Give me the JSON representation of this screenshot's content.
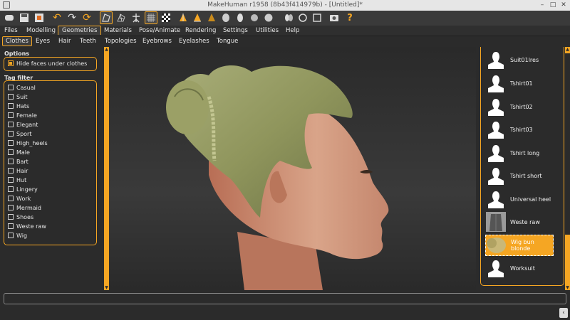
{
  "window": {
    "title": "MakeHuman r1958 (8b43f414979b) - [Untitled]*"
  },
  "toolbar": {
    "icons": [
      "new-file-icon",
      "save-icon",
      "export-icon",
      "undo-icon",
      "redo-icon",
      "reset-icon",
      "smooth-icon",
      "wireframe-icon",
      "pose-icon",
      "grid-icon",
      "checker-icon",
      "front-view-icon",
      "back-view-icon",
      "left-view-icon",
      "right-view-icon",
      "top-view-icon",
      "bottom-view-icon",
      "reset-camera-icon",
      "screenshot-icon",
      "help-icon"
    ]
  },
  "menu": {
    "items": [
      "Files",
      "Modelling",
      "Geometries",
      "Materials",
      "Pose/Animate",
      "Rendering",
      "Settings",
      "Utilities",
      "Help"
    ],
    "active": "Geometries"
  },
  "subtabs": {
    "items": [
      "Clothes",
      "Eyes",
      "Hair",
      "Teeth",
      "Topologies",
      "Eyebrows",
      "Eyelashes",
      "Tongue"
    ],
    "active": "Clothes"
  },
  "options": {
    "title": "Options",
    "hide_faces_label": "Hide faces under clothes",
    "hide_faces_checked": true
  },
  "tag_filter": {
    "title": "Tag filter",
    "tags": [
      "Casual",
      "Suit",
      "Hats",
      "Female",
      "Elegant",
      "Sport",
      "High_heels",
      "Male",
      "Bart",
      "Hair",
      "Hut",
      "Lingery",
      "Work",
      "Mermaid",
      "Shoes",
      "Weste raw",
      "Wig"
    ]
  },
  "clothes_list": {
    "items": [
      {
        "label": "Suit01lres",
        "selected": false
      },
      {
        "label": "Tshirt01",
        "selected": false
      },
      {
        "label": "Tshirt02",
        "selected": false
      },
      {
        "label": "Tshirt03",
        "selected": false
      },
      {
        "label": "Tshirt long",
        "selected": false
      },
      {
        "label": "Tshirt short",
        "selected": false
      },
      {
        "label": "Universal heel",
        "selected": false
      },
      {
        "label": "Weste raw",
        "selected": false
      },
      {
        "label": "Wig bun blonde",
        "selected": true
      },
      {
        "label": "Worksuit",
        "selected": false
      }
    ]
  },
  "colors": {
    "accent": "#f5a623",
    "background": "#2b2b2b",
    "hair": "#9aa06a",
    "skin": "#c98f72"
  }
}
